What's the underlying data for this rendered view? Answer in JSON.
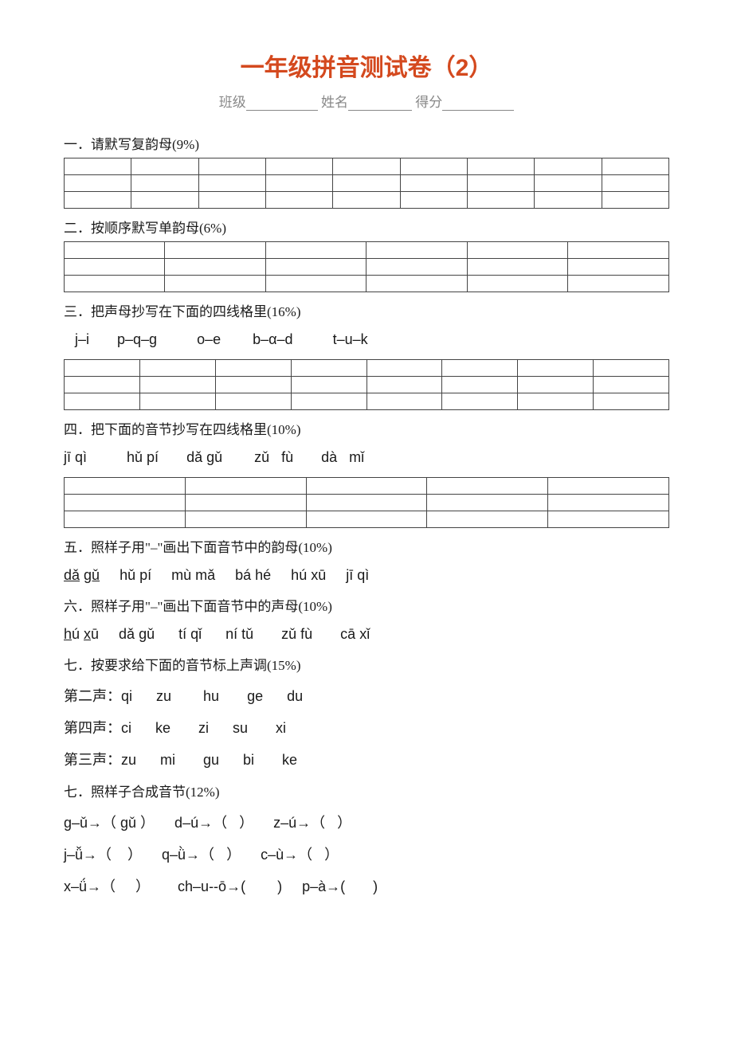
{
  "title": "一年级拼音测试卷（2）",
  "info": {
    "class_label": "班级",
    "name_label": "姓名",
    "score_label": "得分"
  },
  "sections": {
    "s1": "一．请默写复韵母(9%)",
    "s2": "二．按顺序默写单韵母(6%)",
    "s3": "三．把声母抄写在下面的四线格里(16%)",
    "s3_content": "j–i       p–q–g          o–e        b–α–d          t–u–k",
    "s4": "四．把下面的音节抄写在四线格里(10%)",
    "s4_content": "jī qì          hǔ pí       dǎ gǔ        zǔ   fù       dà   mǐ",
    "s5": "五．照样子用\"–\"画出下面音节中的韵母(10%)",
    "s5_content": "dǎ gǔ     hǔ pí     mù mǎ     bá hé     hú xū     jī qì",
    "s6": "六．照样子用\"–\"画出下面音节中的声母(10%)",
    "s6_content": "hú xū     dǎ gǔ      tí qǐ      ní tǔ       zǔ fù       cā xǐ",
    "s7": "七．按要求给下面的音节标上声调(15%)",
    "s7_tone2_label": "第二声：",
    "s7_tone2": "qi      zu        hu       ge      du",
    "s7_tone4_label": "第四声：",
    "s7_tone4": "ci      ke       zi      su       xi",
    "s7_tone3_label": "第三声：",
    "s7_tone3": "zu      mi       gu      bi       ke",
    "s8": "七．照样子合成音节(12%)",
    "s8_line1": "g–ǔ→（ gǔ ）     d–ú→（   ）     z–ú→（   ）",
    "s8_line2": "j–ǚ→（    ）     q–ǜ→（   ）     c–ù→（   ）",
    "s8_line3": "x–ǘ→（     ）       ch–u--ō→(        )     p–à→(       )"
  }
}
